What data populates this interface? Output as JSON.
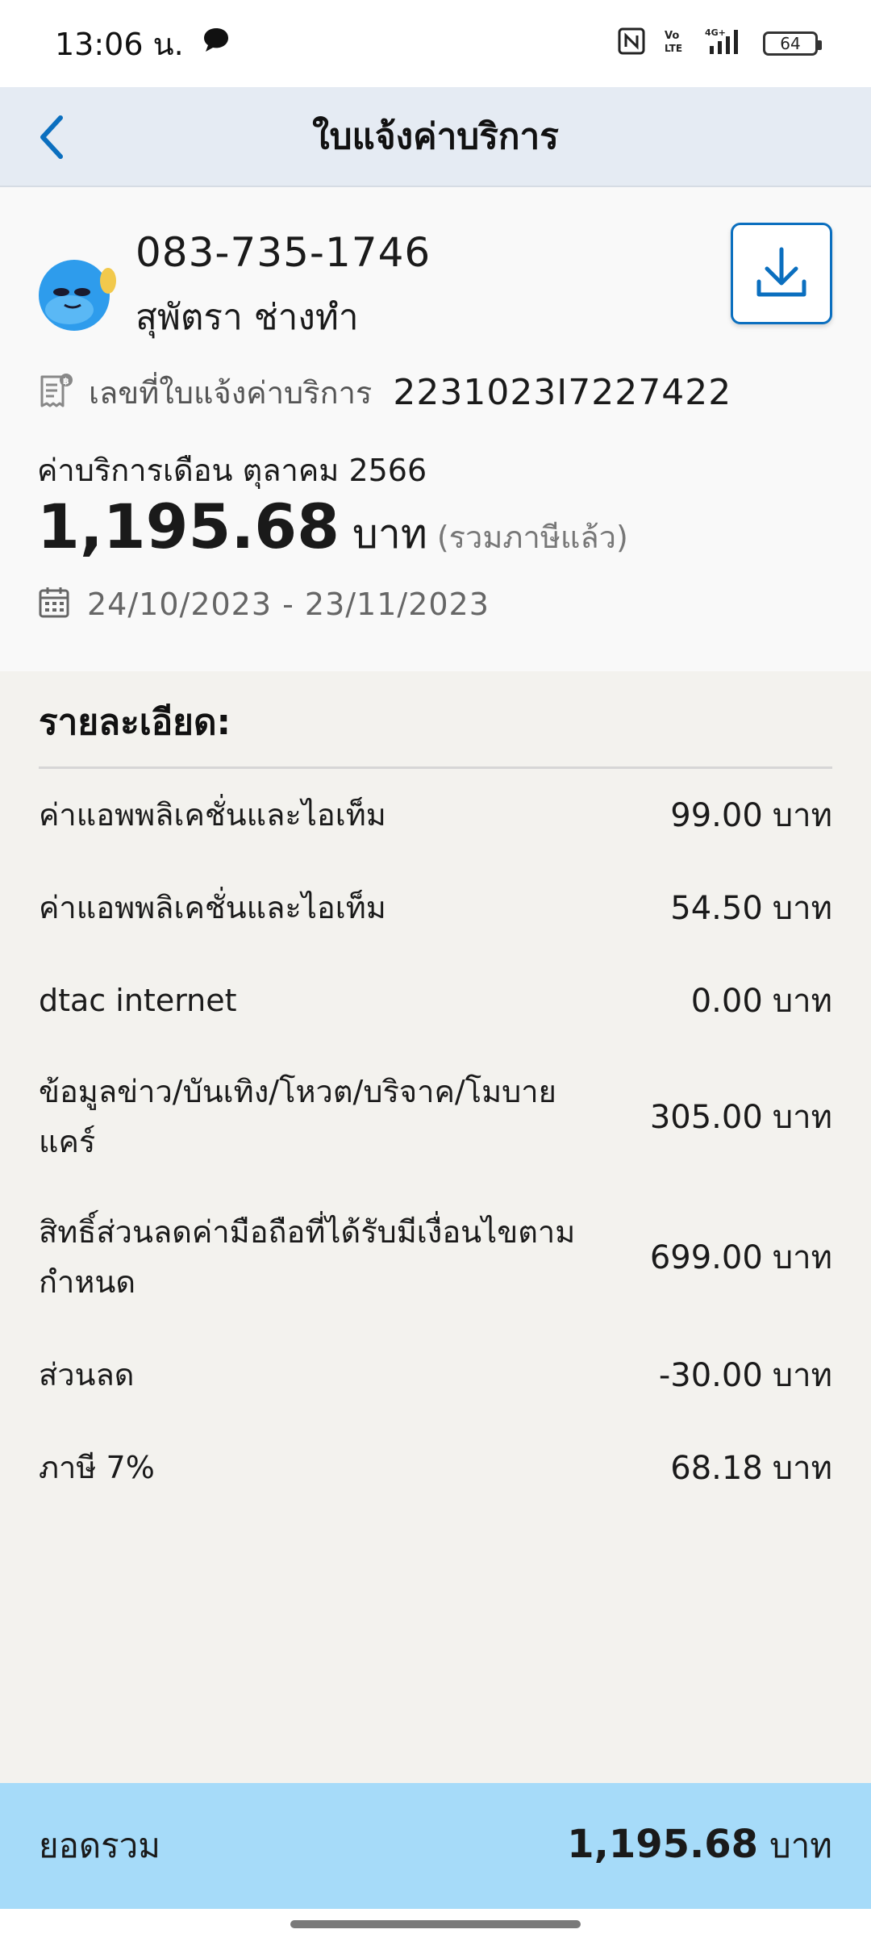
{
  "status_bar": {
    "time": "13:06 น.",
    "battery": "64",
    "network": "4G+"
  },
  "header": {
    "title": "ใบแจ้งค่าบริการ"
  },
  "account": {
    "phone": "083-735-1746",
    "name": "สุพัตรา ช่างทำ",
    "invoice_label": "เลขที่ใบแจ้งค่าบริการ",
    "invoice_number": "2231023I7227422",
    "month_label": "ค่าบริการเดือน ตุลาคม 2566",
    "amount": "1,195.68",
    "currency": "บาท",
    "tax_note": "(รวมภาษีแล้ว)",
    "period": "24/10/2023 - 23/11/2023"
  },
  "details": {
    "title": "รายละเอียด:",
    "items": [
      {
        "label": "ค่าแอพพลิเคชั่นและไอเท็ม",
        "value": "99.00",
        "unit": "บาท"
      },
      {
        "label": "ค่าแอพพลิเคชั่นและไอเท็ม",
        "value": "54.50",
        "unit": "บาท"
      },
      {
        "label": "dtac internet",
        "value": "0.00",
        "unit": "บาท"
      },
      {
        "label": "ข้อมูลข่าว/บันเทิง/โหวต/บริจาค/โมบายแคร์",
        "value": "305.00",
        "unit": "บาท"
      },
      {
        "label": "สิทธิ์ส่วนลดค่ามือถือที่ได้รับมีเงื่อนไขตามกำหนด",
        "value": "699.00",
        "unit": "บาท"
      },
      {
        "label": "ส่วนลด",
        "value": "-30.00",
        "unit": "บาท"
      },
      {
        "label": "ภาษี 7%",
        "value": "68.18",
        "unit": "บาท"
      }
    ]
  },
  "total": {
    "label": "ยอดรวม",
    "value": "1,195.68",
    "unit": "บาท"
  },
  "colors": {
    "accent": "#0b6fbf",
    "header_bg": "#e5ebf3",
    "total_bg": "#a6dbf9"
  }
}
